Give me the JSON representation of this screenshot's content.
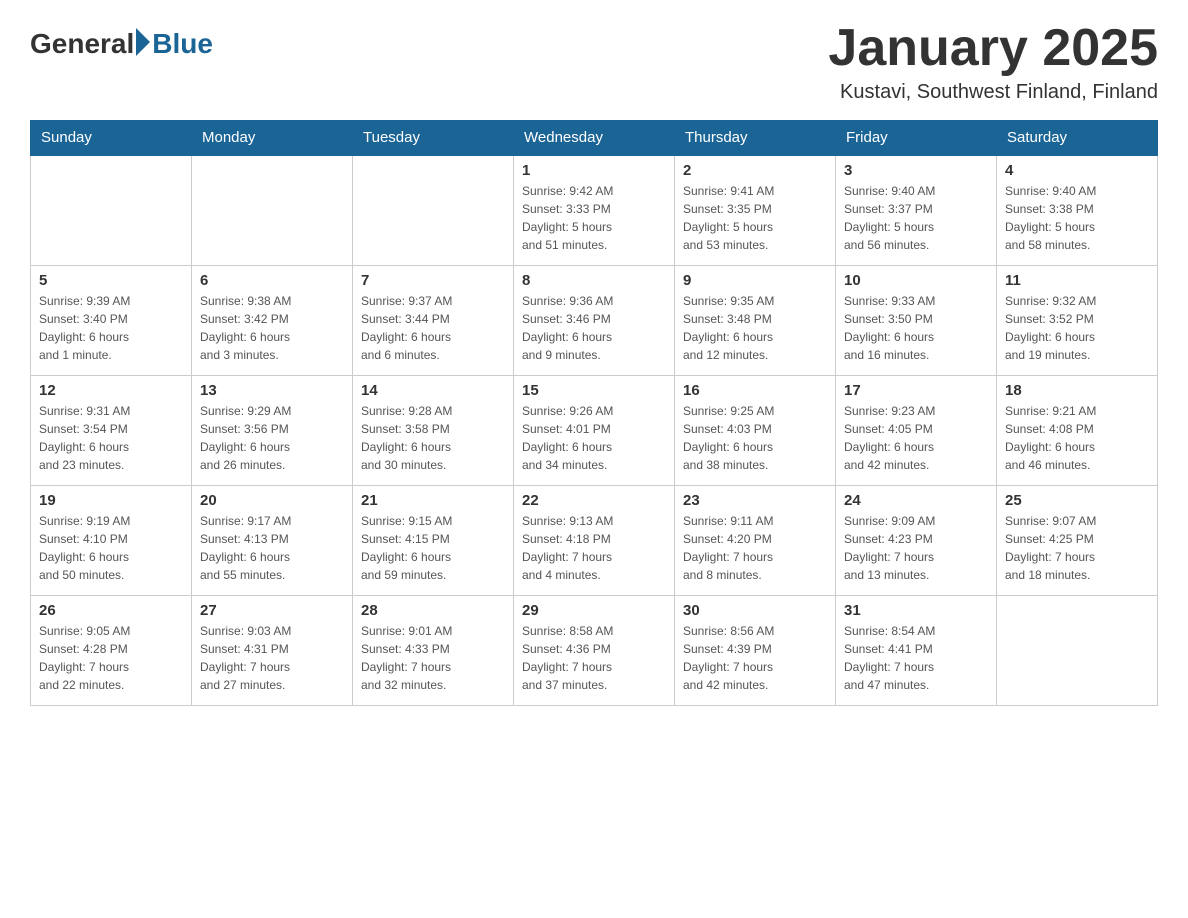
{
  "logo": {
    "text_general": "General",
    "text_blue": "Blue"
  },
  "header": {
    "title": "January 2025",
    "subtitle": "Kustavi, Southwest Finland, Finland"
  },
  "weekdays": [
    "Sunday",
    "Monday",
    "Tuesday",
    "Wednesday",
    "Thursday",
    "Friday",
    "Saturday"
  ],
  "weeks": [
    [
      {
        "day": "",
        "info": ""
      },
      {
        "day": "",
        "info": ""
      },
      {
        "day": "",
        "info": ""
      },
      {
        "day": "1",
        "info": "Sunrise: 9:42 AM\nSunset: 3:33 PM\nDaylight: 5 hours\nand 51 minutes."
      },
      {
        "day": "2",
        "info": "Sunrise: 9:41 AM\nSunset: 3:35 PM\nDaylight: 5 hours\nand 53 minutes."
      },
      {
        "day": "3",
        "info": "Sunrise: 9:40 AM\nSunset: 3:37 PM\nDaylight: 5 hours\nand 56 minutes."
      },
      {
        "day": "4",
        "info": "Sunrise: 9:40 AM\nSunset: 3:38 PM\nDaylight: 5 hours\nand 58 minutes."
      }
    ],
    [
      {
        "day": "5",
        "info": "Sunrise: 9:39 AM\nSunset: 3:40 PM\nDaylight: 6 hours\nand 1 minute."
      },
      {
        "day": "6",
        "info": "Sunrise: 9:38 AM\nSunset: 3:42 PM\nDaylight: 6 hours\nand 3 minutes."
      },
      {
        "day": "7",
        "info": "Sunrise: 9:37 AM\nSunset: 3:44 PM\nDaylight: 6 hours\nand 6 minutes."
      },
      {
        "day": "8",
        "info": "Sunrise: 9:36 AM\nSunset: 3:46 PM\nDaylight: 6 hours\nand 9 minutes."
      },
      {
        "day": "9",
        "info": "Sunrise: 9:35 AM\nSunset: 3:48 PM\nDaylight: 6 hours\nand 12 minutes."
      },
      {
        "day": "10",
        "info": "Sunrise: 9:33 AM\nSunset: 3:50 PM\nDaylight: 6 hours\nand 16 minutes."
      },
      {
        "day": "11",
        "info": "Sunrise: 9:32 AM\nSunset: 3:52 PM\nDaylight: 6 hours\nand 19 minutes."
      }
    ],
    [
      {
        "day": "12",
        "info": "Sunrise: 9:31 AM\nSunset: 3:54 PM\nDaylight: 6 hours\nand 23 minutes."
      },
      {
        "day": "13",
        "info": "Sunrise: 9:29 AM\nSunset: 3:56 PM\nDaylight: 6 hours\nand 26 minutes."
      },
      {
        "day": "14",
        "info": "Sunrise: 9:28 AM\nSunset: 3:58 PM\nDaylight: 6 hours\nand 30 minutes."
      },
      {
        "day": "15",
        "info": "Sunrise: 9:26 AM\nSunset: 4:01 PM\nDaylight: 6 hours\nand 34 minutes."
      },
      {
        "day": "16",
        "info": "Sunrise: 9:25 AM\nSunset: 4:03 PM\nDaylight: 6 hours\nand 38 minutes."
      },
      {
        "day": "17",
        "info": "Sunrise: 9:23 AM\nSunset: 4:05 PM\nDaylight: 6 hours\nand 42 minutes."
      },
      {
        "day": "18",
        "info": "Sunrise: 9:21 AM\nSunset: 4:08 PM\nDaylight: 6 hours\nand 46 minutes."
      }
    ],
    [
      {
        "day": "19",
        "info": "Sunrise: 9:19 AM\nSunset: 4:10 PM\nDaylight: 6 hours\nand 50 minutes."
      },
      {
        "day": "20",
        "info": "Sunrise: 9:17 AM\nSunset: 4:13 PM\nDaylight: 6 hours\nand 55 minutes."
      },
      {
        "day": "21",
        "info": "Sunrise: 9:15 AM\nSunset: 4:15 PM\nDaylight: 6 hours\nand 59 minutes."
      },
      {
        "day": "22",
        "info": "Sunrise: 9:13 AM\nSunset: 4:18 PM\nDaylight: 7 hours\nand 4 minutes."
      },
      {
        "day": "23",
        "info": "Sunrise: 9:11 AM\nSunset: 4:20 PM\nDaylight: 7 hours\nand 8 minutes."
      },
      {
        "day": "24",
        "info": "Sunrise: 9:09 AM\nSunset: 4:23 PM\nDaylight: 7 hours\nand 13 minutes."
      },
      {
        "day": "25",
        "info": "Sunrise: 9:07 AM\nSunset: 4:25 PM\nDaylight: 7 hours\nand 18 minutes."
      }
    ],
    [
      {
        "day": "26",
        "info": "Sunrise: 9:05 AM\nSunset: 4:28 PM\nDaylight: 7 hours\nand 22 minutes."
      },
      {
        "day": "27",
        "info": "Sunrise: 9:03 AM\nSunset: 4:31 PM\nDaylight: 7 hours\nand 27 minutes."
      },
      {
        "day": "28",
        "info": "Sunrise: 9:01 AM\nSunset: 4:33 PM\nDaylight: 7 hours\nand 32 minutes."
      },
      {
        "day": "29",
        "info": "Sunrise: 8:58 AM\nSunset: 4:36 PM\nDaylight: 7 hours\nand 37 minutes."
      },
      {
        "day": "30",
        "info": "Sunrise: 8:56 AM\nSunset: 4:39 PM\nDaylight: 7 hours\nand 42 minutes."
      },
      {
        "day": "31",
        "info": "Sunrise: 8:54 AM\nSunset: 4:41 PM\nDaylight: 7 hours\nand 47 minutes."
      },
      {
        "day": "",
        "info": ""
      }
    ]
  ]
}
